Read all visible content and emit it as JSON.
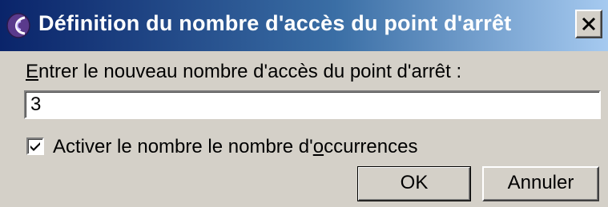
{
  "window": {
    "title": "Définition du nombre d'accès du point d'arrêt",
    "title_icon": "breakpoint-hitcount-icon",
    "close_icon": "close-icon"
  },
  "form": {
    "prompt_first_letter": "E",
    "prompt_rest": "ntrer le nouveau nombre d'accès du point d'arrêt :",
    "value": "3",
    "checkbox_checked": true,
    "checkbox_label_before": "Activer le nombre le nombre d'",
    "checkbox_label_mnemonic": "o",
    "checkbox_label_after": "ccurrences"
  },
  "buttons": {
    "ok_label": "OK",
    "cancel_label": "Annuler"
  },
  "colors": {
    "titlebar_start": "#0a246a",
    "titlebar_end": "#a6caf0",
    "dialog_face": "#d4d0c8"
  }
}
